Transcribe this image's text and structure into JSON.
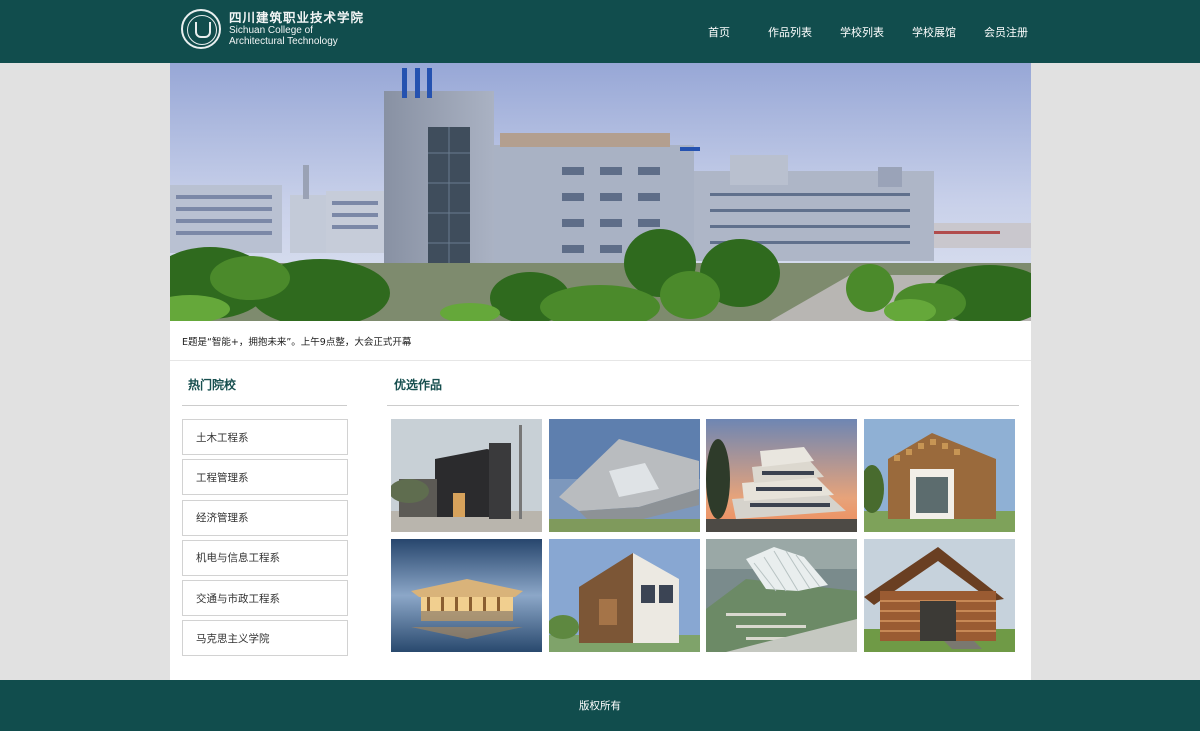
{
  "header": {
    "logo_cn": "四川建筑职业技术学院",
    "logo_en_line1": "Sichuan College of",
    "logo_en_line2": "Architectural Technology",
    "nav": [
      "首页",
      "作品列表",
      "学校列表",
      "学校展馆",
      "会员注册"
    ]
  },
  "banner": {
    "subject": "campus buildings"
  },
  "notice": {
    "text": "E题是“智能+，拥抱未来”。上午9点整，大会正式开幕"
  },
  "sidebar": {
    "title": "热门院校",
    "items": [
      "土木工程系",
      "工程管理系",
      "经济管理系",
      "机电与信息工程系",
      "交通与市政工程系",
      "马克思主义学院"
    ]
  },
  "gallery": {
    "title": "优选作品",
    "items": [
      "dark-timber-house",
      "angular-concrete-hall",
      "stacked-balcony-building",
      "wood-panel-pavilion",
      "lakeside-pavilion",
      "wood-clad-house",
      "shell-roof-pavilion",
      "wooden-lattice-pavilion"
    ]
  },
  "footer": {
    "text": "版权所有"
  },
  "colors": {
    "brand": "#114d4d",
    "accent_text": "#174f4f",
    "page_bg": "#e1e1e1"
  }
}
